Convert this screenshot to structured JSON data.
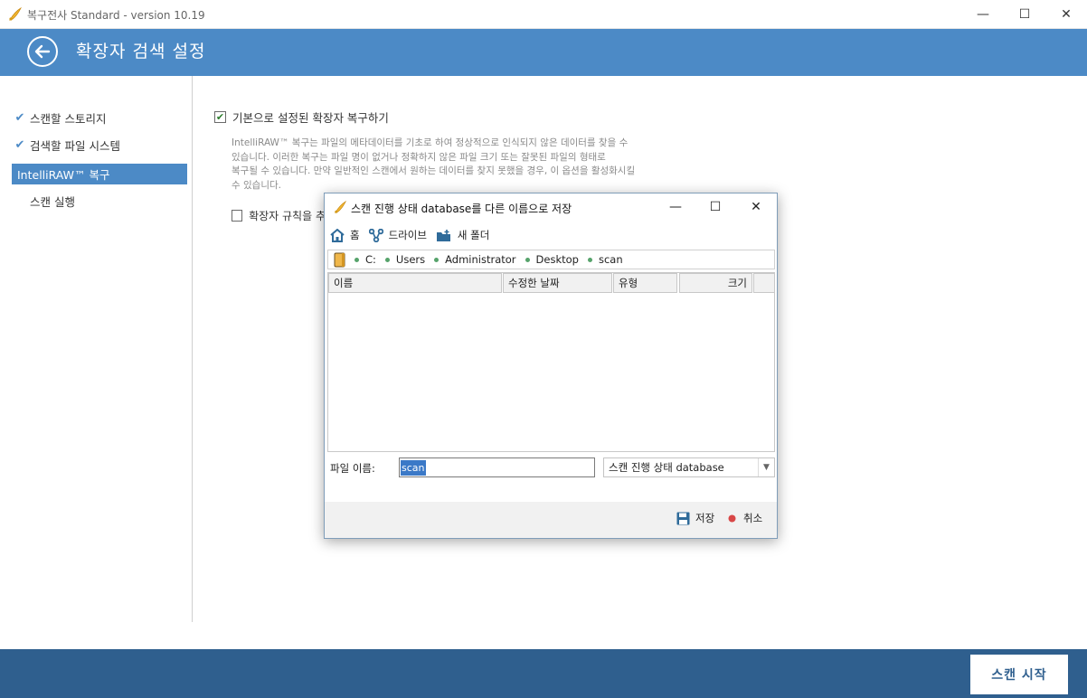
{
  "window": {
    "title": "복구전사 Standard - version 10.19",
    "controls": [
      "—",
      "☐",
      "✕"
    ]
  },
  "header": {
    "title": "확장자 검색 설정"
  },
  "sidebar": {
    "items": [
      {
        "label": "스캔할 스토리지",
        "done": true,
        "active": false
      },
      {
        "label": "검색할 파일 시스템",
        "done": true,
        "active": false
      },
      {
        "label": "IntelliRAW™ 복구",
        "done": false,
        "active": true
      },
      {
        "label": "스캔 실행",
        "done": false,
        "active": false
      }
    ]
  },
  "main": {
    "default_ext_checkbox": {
      "label": "기본으로 설정된 확장자 복구하기",
      "checked": true
    },
    "description_lines": [
      "IntelliRAW™ 복구는 파일의 메타데이터를 기초로 하여 정상적으로 인식되지 않은 데이터를 찾을 수",
      "있습니다. 이러한 복구는 파일 명이 없거나 정확하지 않은 파일 크기 또는 잘못된 파일의 형태로",
      "복구될 수 있습니다. 만약 일반적인 스캔에서 원하는 데이터를 찾지 못했을 경우, 이 옵션을 활성화시킬",
      "수 있습니다."
    ],
    "rule_checkbox": {
      "label": "확장자 규칙을 추",
      "checked": false
    }
  },
  "footer": {
    "start_label": "스캔 시작"
  },
  "dialog": {
    "title": "스캔 진행 상태 database를 다른 이름으로 저장",
    "controls": [
      "—",
      "☐",
      "✕"
    ],
    "toolbar": {
      "home": "홈",
      "drive": "드라이브",
      "new_folder": "새 폴더"
    },
    "path": [
      "C:",
      "Users",
      "Administrator",
      "Desktop",
      "scan"
    ],
    "columns": [
      "이름",
      "수정한 날짜",
      "유형",
      "크기"
    ],
    "filename_label": "파일 이름:",
    "filename_value": "scan",
    "filetype": "스캔 진행 상태 database",
    "save_label": "저장",
    "cancel_label": "취소"
  },
  "colors": {
    "header": "#4c8ac6",
    "footer": "#2f5f8e",
    "active_nav": "#4c8ac6",
    "check": "#2d7d2d"
  }
}
